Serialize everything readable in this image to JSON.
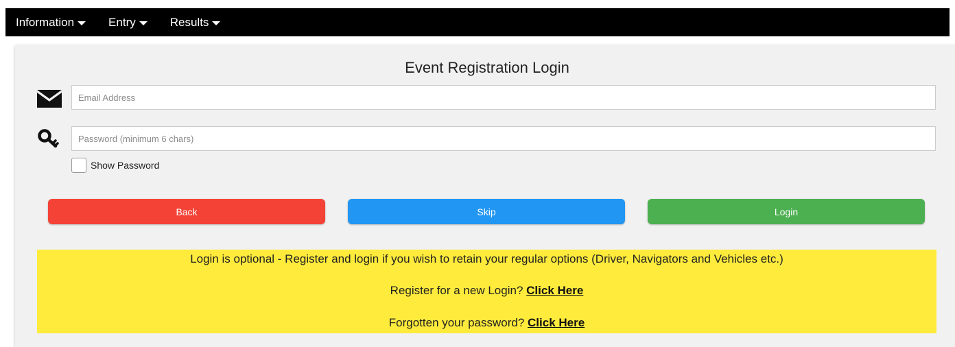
{
  "nav": {
    "items": [
      {
        "label": "Information"
      },
      {
        "label": "Entry"
      },
      {
        "label": "Results"
      }
    ]
  },
  "form": {
    "title": "Event Registration Login",
    "email_placeholder": "Email Address",
    "email_value": "",
    "password_placeholder": "Password (minimum 6 chars)",
    "password_value": "",
    "show_password_label": "Show Password",
    "show_password_checked": false
  },
  "buttons": {
    "back": {
      "label": "Back",
      "color": "#f44336"
    },
    "skip": {
      "label": "Skip",
      "color": "#2196f3"
    },
    "login": {
      "label": "Login",
      "color": "#4caf50"
    }
  },
  "notice": {
    "bg_color": "#ffeb3b",
    "line1": "Login is optional - Register and login if you wish to retain your regular options (Driver, Navigators and Vehicles etc.)",
    "register_text": "Register for a new Login?",
    "register_link": "Click Here",
    "forgot_text": "Forgotten your password?",
    "forgot_link": "Click Here"
  },
  "icons": {
    "email": "envelope-icon",
    "password": "key-icon",
    "dropdown": "caret-down-icon"
  }
}
